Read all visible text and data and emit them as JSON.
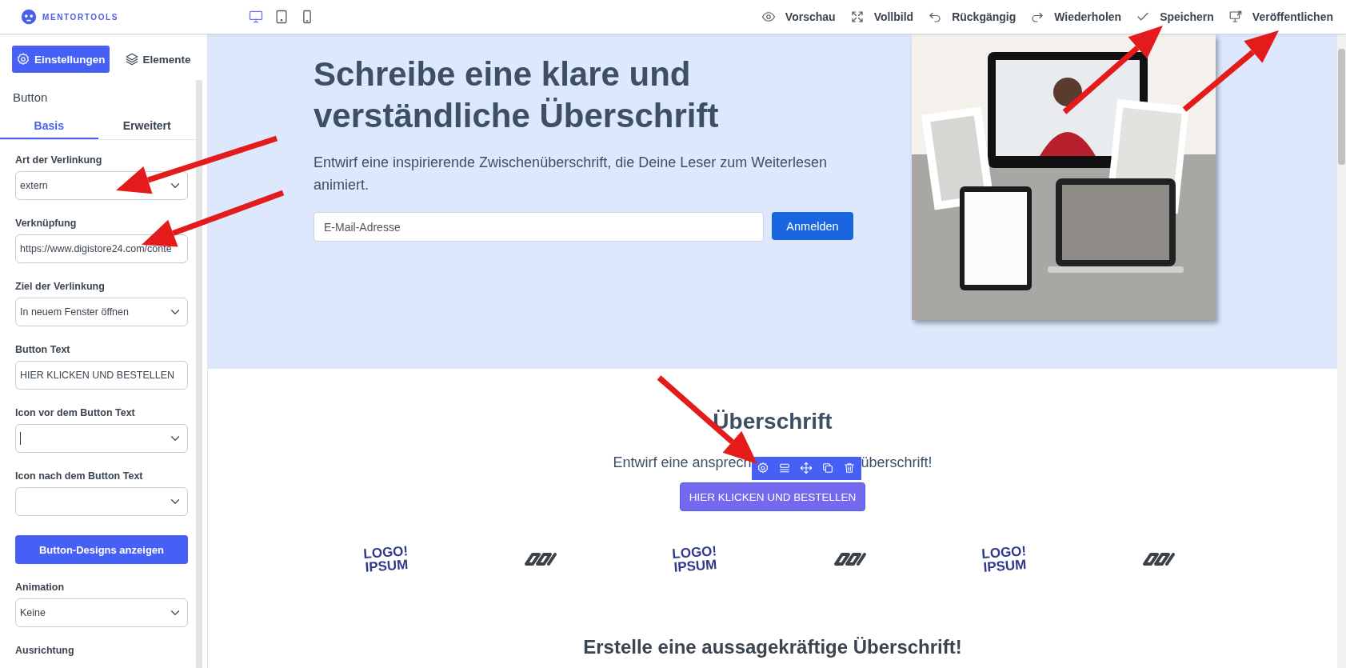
{
  "brand": {
    "name": "MENTORTOOLS"
  },
  "devices": [
    {
      "kind": "desktop",
      "selected": true
    },
    {
      "kind": "tablet",
      "selected": false
    },
    {
      "kind": "phone",
      "selected": false
    }
  ],
  "actions": [
    {
      "kind": "eye",
      "label": "Vorschau"
    },
    {
      "kind": "expand",
      "label": "Vollbild"
    },
    {
      "kind": "undo",
      "label": "Rückgängig"
    },
    {
      "kind": "redo",
      "label": "Wiederholen"
    },
    {
      "kind": "check",
      "label": "Speichern"
    },
    {
      "kind": "monitor",
      "label": "Veröffentlichen"
    }
  ],
  "sidebar": {
    "tabs": [
      {
        "kind": "gear",
        "label": "Einstellungen",
        "selected": true
      },
      {
        "kind": "layers",
        "label": "Elemente",
        "selected": false
      }
    ],
    "section_title": "Button",
    "subtabs": [
      {
        "label": "Basis",
        "selected": true
      },
      {
        "label": "Erweitert",
        "selected": false
      }
    ],
    "fields": [
      {
        "kind": "select",
        "label": "Art der Verlinkung",
        "value": "extern"
      },
      {
        "kind": "input",
        "label": "Verknüpfung",
        "value": "https://www.digistore24.com/conte"
      },
      {
        "kind": "select",
        "label": "Ziel der Verlinkung",
        "value": "In neuem Fenster öffnen"
      },
      {
        "kind": "input",
        "label": "Button Text",
        "value": "HIER KLICKEN UND BESTELLEN"
      },
      {
        "kind": "select",
        "label": "Icon vor dem Button Text",
        "focused": true
      },
      {
        "kind": "select",
        "label": "Icon nach dem Button Text"
      },
      {
        "kind": "button",
        "label": "Button-Designs anzeigen"
      },
      {
        "kind": "select",
        "label": "Animation",
        "value": "Keine"
      },
      {
        "kind": "label",
        "label": "Ausrichtung"
      }
    ]
  },
  "hero": {
    "title": "Schreibe eine klare und verständliche Überschrift",
    "subtitle": "Entwirf eine inspirierende Zwischenüberschrift, die Deine Leser zum Weiterlesen animiert.",
    "email": {
      "placeholder": "E-Mail-Adresse"
    },
    "button": "Anmelden"
  },
  "section": {
    "title": "Überschrift",
    "subtitle_start": "Entwirf eine ansprech",
    "subtitle_end": "überschrift!",
    "toolbar": [
      {
        "kind": "gear"
      },
      {
        "kind": "rows"
      },
      {
        "kind": "move"
      },
      {
        "kind": "copy"
      },
      {
        "kind": "trash"
      }
    ],
    "button": "HIER KLICKEN UND BESTELLEN"
  },
  "logos": [
    {
      "kind": "text",
      "lines": [
        "LOGO!",
        "IPSUM"
      ]
    },
    {
      "kind": "chain"
    },
    {
      "kind": "text",
      "lines": [
        "LOGO!",
        "IPSUM"
      ]
    },
    {
      "kind": "chain"
    },
    {
      "kind": "text",
      "lines": [
        "LOGO!",
        "IPSUM"
      ]
    },
    {
      "kind": "chain"
    }
  ],
  "next_title": "Erstelle eine aussagekräftige Überschrift!",
  "annotations": [
    {
      "kind": "arrow"
    },
    {
      "kind": "arrow"
    },
    {
      "kind": "arrow"
    },
    {
      "kind": "arrow"
    },
    {
      "kind": "arrow"
    }
  ]
}
